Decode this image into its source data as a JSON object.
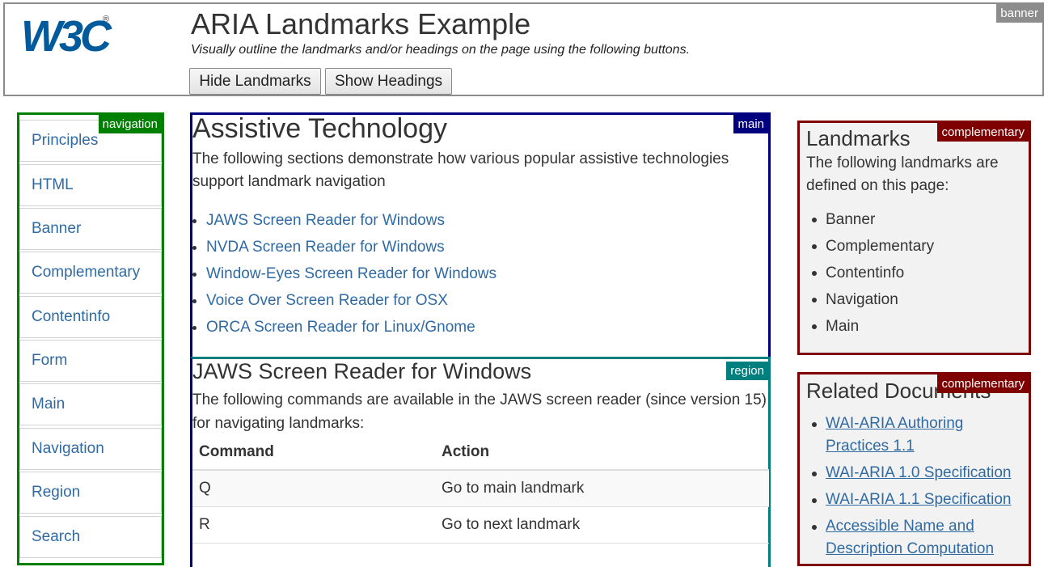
{
  "banner": {
    "label": "banner",
    "logo_text": "W3C",
    "title": "ARIA Landmarks Example",
    "subtitle": "Visually outline the landmarks and/or headings on the page using the following buttons.",
    "hide_landmarks_label": "Hide Landmarks",
    "show_headings_label": "Show Headings"
  },
  "navigation": {
    "label": "navigation",
    "items": [
      {
        "label": "Principles"
      },
      {
        "label": "HTML"
      },
      {
        "label": "Banner"
      },
      {
        "label": "Complementary"
      },
      {
        "label": "Contentinfo"
      },
      {
        "label": "Form"
      },
      {
        "label": "Main"
      },
      {
        "label": "Navigation"
      },
      {
        "label": "Region"
      },
      {
        "label": "Search"
      }
    ]
  },
  "main": {
    "label": "main",
    "heading": "Assistive Technology",
    "intro": "The following sections demonstrate how various popular assistive technologies support landmark navigation",
    "links": [
      {
        "label": "JAWS Screen Reader for Windows"
      },
      {
        "label": "NVDA Screen Reader for Windows"
      },
      {
        "label": "Window-Eyes Screen Reader for Windows"
      },
      {
        "label": "Voice Over Screen Reader for OSX"
      },
      {
        "label": "ORCA Screen Reader for Linux/Gnome"
      }
    ]
  },
  "region": {
    "label": "region",
    "heading": "JAWS Screen Reader for Windows",
    "intro": "The following commands are available in the JAWS screen reader (since version 15) for navigating landmarks:",
    "table": {
      "headers": [
        "Command",
        "Action"
      ],
      "rows": [
        [
          "Q",
          "Go to main landmark"
        ],
        [
          "R",
          "Go to next landmark"
        ]
      ]
    }
  },
  "complementary_landmarks": {
    "label": "complementary",
    "heading": "Landmarks",
    "description": "The following landmarks are defined on this page:",
    "items": [
      "Banner",
      "Complementary",
      "Contentinfo",
      "Navigation",
      "Main"
    ]
  },
  "complementary_related": {
    "label": "complementary",
    "heading": "Related Documents",
    "links": [
      {
        "label": "WAI-ARIA Authoring Practices 1.1"
      },
      {
        "label": "WAI-ARIA 1.0 Specification"
      },
      {
        "label": "WAI-ARIA 1.1 Specification"
      },
      {
        "label": "Accessible Name and Description Computation"
      }
    ]
  },
  "colors": {
    "banner": "#8c8c8c",
    "navigation": "#008000",
    "main": "#00007f",
    "region": "#007f7f",
    "complementary": "#7f0000",
    "logo": "#005a9c",
    "link": "#2f6aa3"
  }
}
